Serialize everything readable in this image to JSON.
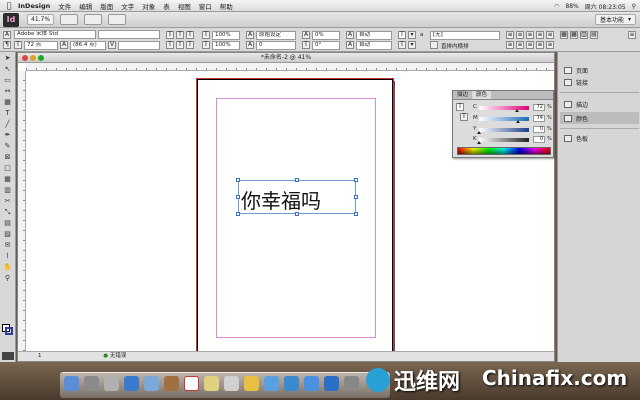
{
  "menubar": {
    "app_name": "InDesign",
    "items": [
      "文件",
      "编辑",
      "版面",
      "文字",
      "对象",
      "表",
      "视图",
      "窗口",
      "帮助"
    ],
    "clock": "周六 08:23:05",
    "battery": "88%"
  },
  "appbar": {
    "logo": "Id",
    "zoom": "41.7%",
    "workspace": "基本功能"
  },
  "control": {
    "font_family": "Adobe 宋体 Std",
    "font_size": "72 点",
    "leading": "(86.4 点)",
    "scale_h": "100%",
    "scale_v": "100%",
    "kerning": "原始设定",
    "tracking": "0",
    "baseline": "0%",
    "skew": "0°",
    "auto": "自动",
    "lang": "[无]",
    "grid_label": "直排内横排"
  },
  "document": {
    "title": "*未命名-2 @ 41%",
    "text": "你幸福吗",
    "status": "无错误",
    "page_num": "1"
  },
  "color_panel": {
    "tabs": [
      "描边",
      "颜色"
    ],
    "channels": [
      {
        "label": "C",
        "value": "72",
        "gradient": [
          "#ffffff",
          "#e0007a"
        ]
      },
      {
        "label": "M",
        "value": "74",
        "gradient": [
          "#ffffff",
          "#1d6ab8"
        ]
      },
      {
        "label": "Y",
        "value": "0",
        "gradient": [
          "#ffffff",
          "#1d3f8a"
        ]
      },
      {
        "label": "K",
        "value": "0",
        "gradient": [
          "#ffffff",
          "#222222"
        ]
      }
    ],
    "percent": "%"
  },
  "right_dock": {
    "items": [
      "页面",
      "链接",
      "描边",
      "颜色",
      "色板"
    ]
  },
  "watermark": {
    "cn": "迅维网",
    "en": "Chinafix.com"
  },
  "colors": {
    "bleed": "#c0392b",
    "margin": "#d68fd2",
    "frame": "#6f9bd5"
  }
}
